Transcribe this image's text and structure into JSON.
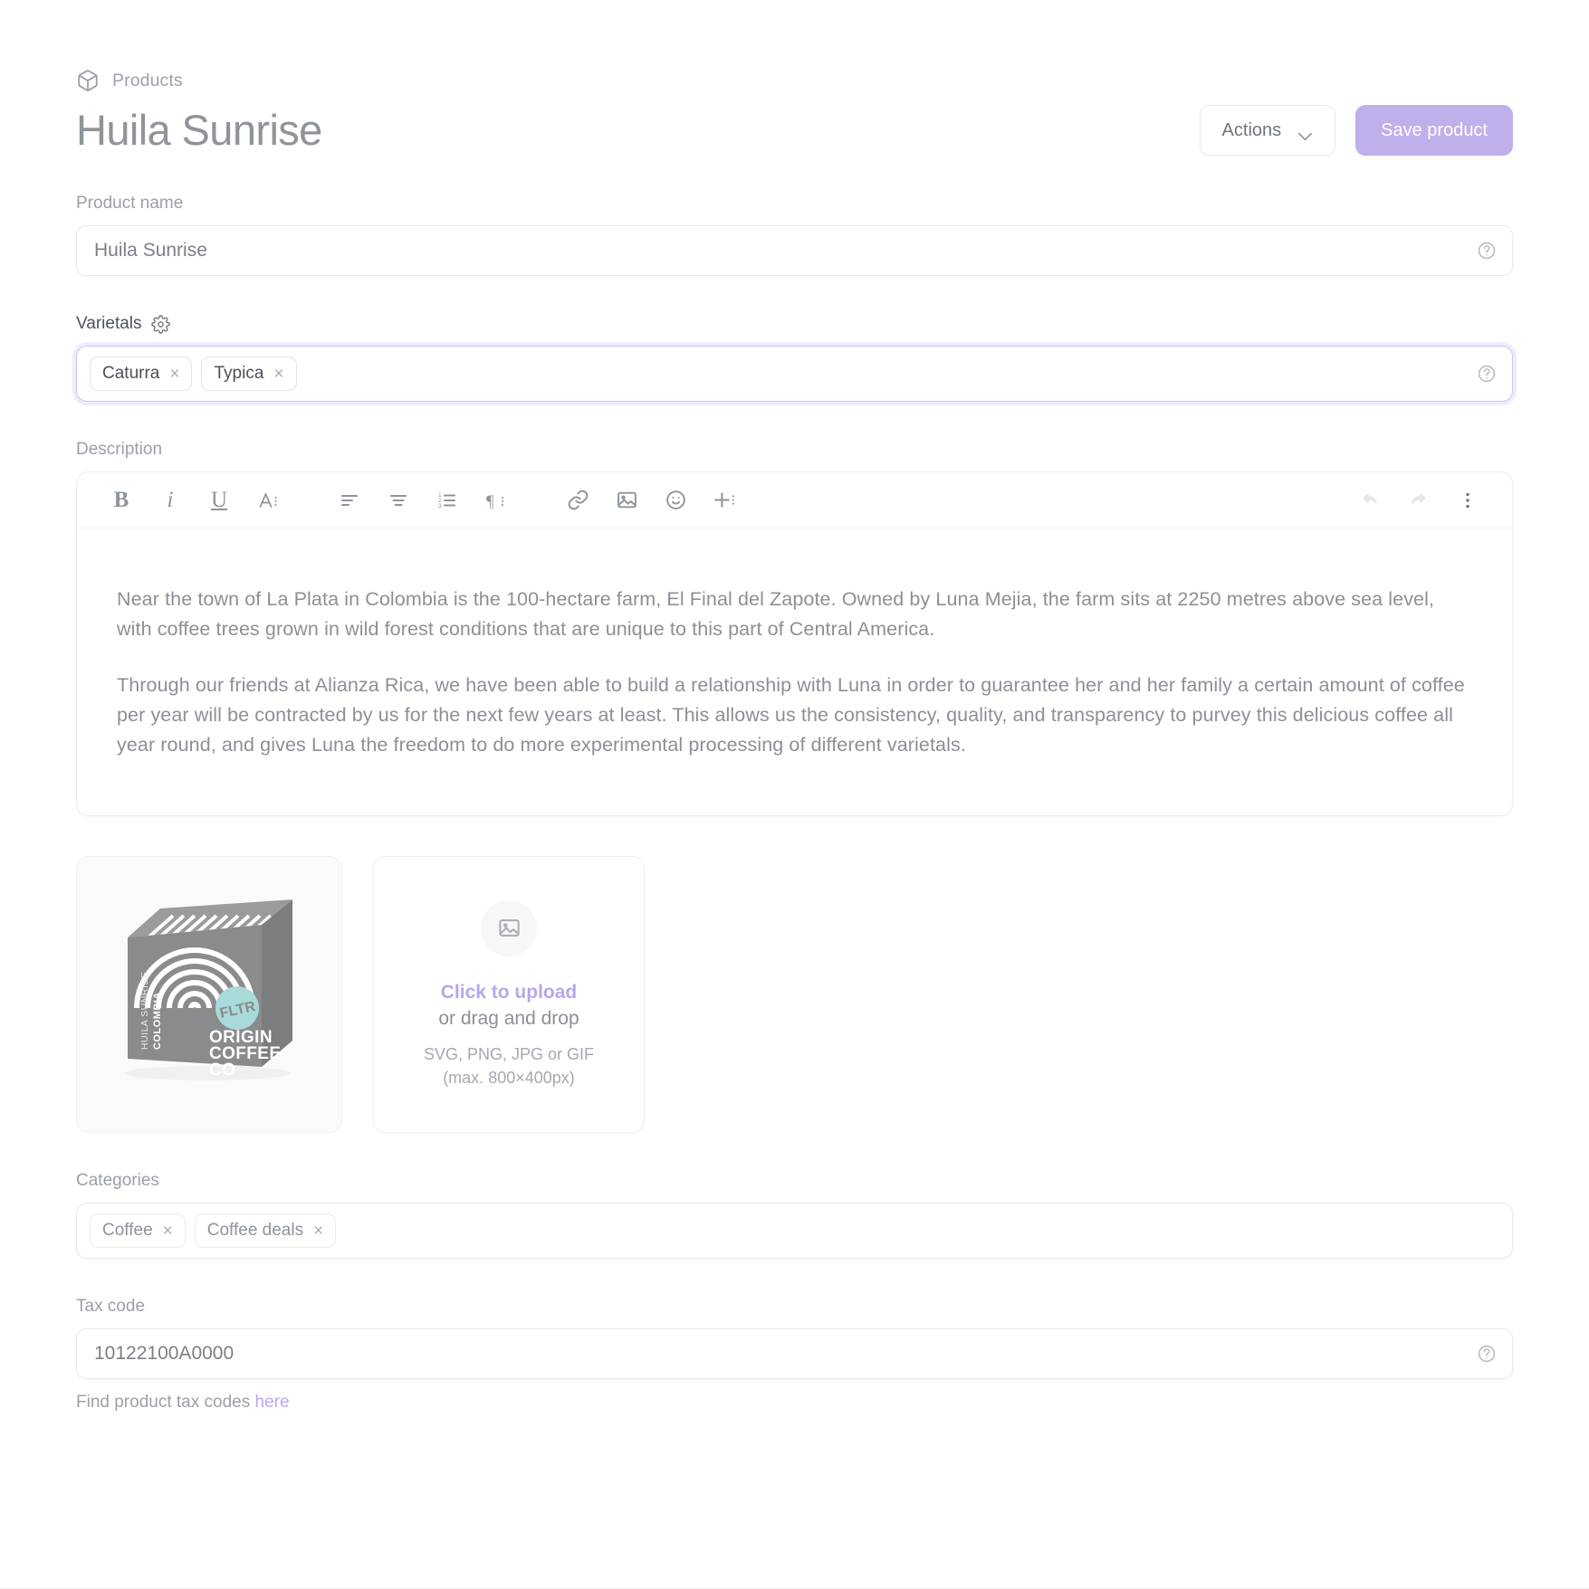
{
  "breadcrumb": {
    "icon": "cube-icon",
    "label": "Products"
  },
  "header": {
    "title": "Huila Sunrise",
    "actions_label": "Actions",
    "save_label": "Save product",
    "accent_color": "#bfb0ec"
  },
  "product_name": {
    "label": "Product name",
    "value": "Huila Sunrise",
    "placeholder": "Product name",
    "help_icon": "question-circle-icon"
  },
  "varietals": {
    "label": "Varietals",
    "settings_icon": "gear-icon",
    "focused": true,
    "help_icon": "question-circle-icon",
    "tags": [
      {
        "label": "Caturra",
        "remove": "×"
      },
      {
        "label": "Typica",
        "remove": "×"
      }
    ]
  },
  "description": {
    "label": "Description",
    "toolbar": [
      {
        "name": "bold-icon",
        "label": "B"
      },
      {
        "name": "italic-icon",
        "label": "i"
      },
      {
        "name": "underline-icon",
        "label": "U"
      },
      {
        "name": "text-style-icon",
        "label": "A"
      },
      {
        "name": "align-left-icon",
        "label": ""
      },
      {
        "name": "align-center-icon",
        "label": ""
      },
      {
        "name": "ordered-list-icon",
        "label": ""
      },
      {
        "name": "paragraph-icon",
        "label": ""
      },
      {
        "name": "link-icon",
        "label": ""
      },
      {
        "name": "image-icon",
        "label": ""
      },
      {
        "name": "emoji-icon",
        "label": ""
      },
      {
        "name": "insert-plus-icon",
        "label": ""
      },
      {
        "name": "undo-icon",
        "label": ""
      },
      {
        "name": "redo-icon",
        "label": ""
      },
      {
        "name": "more-options-icon",
        "label": ""
      }
    ],
    "paragraphs": [
      "Near the town of La Plata in Colombia is the 100-hectare farm, El Final del Zapote. Owned by Luna Mejia, the farm sits at 2250 metres above sea level, with coffee trees grown in wild forest conditions that are unique to this part of Central America.",
      "Through our friends at Alianza Rica, we have been able to build a relationship with Luna in order to guarantee her and her family a certain amount of coffee per year will be contracted by us for the next few years at least. This allows us the consistency, quality, and transparency to purvey this delicious coffee all year round, and gives Luna the freedom to do more experimental processing of different varietals."
    ]
  },
  "product_image": {
    "alt": "Huila Sunrise coffee box",
    "box_text_vertical_1": "HUILA SUNRISE",
    "box_text_vertical_2": "COLOMBIA",
    "brand_line_1": "ORIGIN",
    "brand_line_2": "COFFEE",
    "brand_line_3": "CO",
    "badge_text": "FLTR",
    "badge_color": "#a9dbdb",
    "box_color": "#8a8b8d"
  },
  "upload": {
    "icon": "image-placeholder-icon",
    "click_label": "Click to upload",
    "drag_label": "or drag and drop",
    "formats": "SVG, PNG, JPG or GIF",
    "max_size": "(max. 800×400px)",
    "accent_color": "#b8a6ea"
  },
  "categories": {
    "label": "Categories",
    "tags": [
      {
        "label": "Coffee",
        "remove": "×"
      },
      {
        "label": "Coffee deals",
        "remove": "×"
      }
    ]
  },
  "tax_code": {
    "label": "Tax code",
    "value": "10122100A0000",
    "placeholder": "Tax code",
    "help_icon": "question-circle-icon",
    "helper_prefix": "Find product tax codes ",
    "helper_link": "here"
  }
}
